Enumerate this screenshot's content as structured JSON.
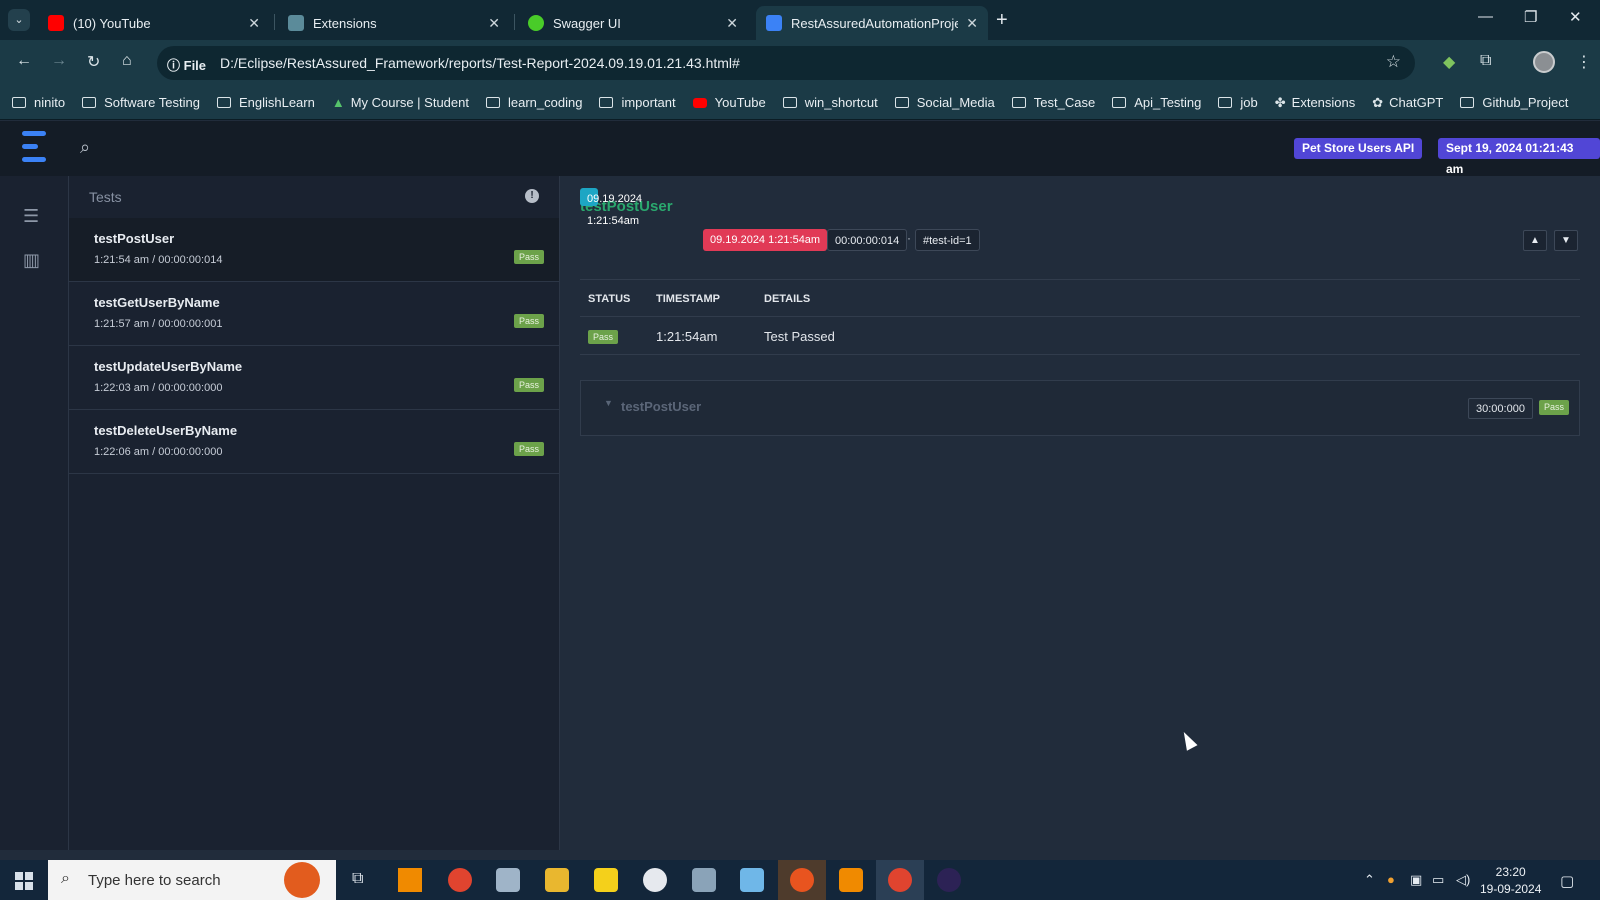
{
  "browser": {
    "tabs": [
      {
        "title": "(10) YouTube",
        "icon": "youtube-icon"
      },
      {
        "title": "Extensions",
        "icon": "puzzle-icon"
      },
      {
        "title": "Swagger UI",
        "icon": "swagger-icon"
      },
      {
        "title": "RestAssuredAutomationProject",
        "icon": "extent-report-icon",
        "active": true
      }
    ],
    "address": {
      "scheme_label": "File",
      "url": "D:/Eclipse/RestAssured_Framework/reports/Test-Report-2024.09.19.01.21.43.html#"
    },
    "bookmarks": [
      {
        "label": "ninito",
        "icon": "folder-icon"
      },
      {
        "label": "Software Testing",
        "icon": "folder-icon"
      },
      {
        "label": "EnglishLearn",
        "icon": "folder-icon"
      },
      {
        "label": "My Course | Student",
        "icon": "course-icon"
      },
      {
        "label": "learn_coding",
        "icon": "folder-icon"
      },
      {
        "label": "important",
        "icon": "folder-icon"
      },
      {
        "label": "YouTube",
        "icon": "youtube-icon"
      },
      {
        "label": "win_shortcut",
        "icon": "folder-icon"
      },
      {
        "label": "Social_Media",
        "icon": "folder-icon"
      },
      {
        "label": "Test_Case",
        "icon": "folder-icon"
      },
      {
        "label": "Api_Testing",
        "icon": "folder-icon"
      },
      {
        "label": "job",
        "icon": "folder-icon"
      },
      {
        "label": "Extensions",
        "icon": "puzzle-icon"
      },
      {
        "label": "ChatGPT",
        "icon": "chatgpt-icon"
      },
      {
        "label": "Github_Project",
        "icon": "folder-icon"
      }
    ]
  },
  "report": {
    "header": {
      "suite_badge": "Pet Store Users API",
      "date_badge": "Sept 19, 2024 01:21:43 am"
    },
    "list": {
      "heading": "Tests",
      "tests": [
        {
          "name": "testPostUser",
          "meta": "1:21:54 am / 00:00:00:014",
          "status": "Pass",
          "active": true
        },
        {
          "name": "testGetUserByName",
          "meta": "1:21:57 am / 00:00:00:001",
          "status": "Pass"
        },
        {
          "name": "testUpdateUserByName",
          "meta": "1:22:03 am / 00:00:00:000",
          "status": "Pass"
        },
        {
          "name": "testDeleteUserByName",
          "meta": "1:22:06 am / 00:00:00:000",
          "status": "Pass"
        }
      ]
    },
    "detail": {
      "title": "testPostUser",
      "start_time": "09.19.2024 1:21:54am",
      "end_time": "09.19.2024 1:21:54am",
      "duration": "00:00:00:014",
      "separator": "·",
      "test_id": "#test-id=1",
      "table": {
        "headers": [
          "STATUS",
          "TIMESTAMP",
          "DETAILS"
        ],
        "rows": [
          {
            "status": "Pass",
            "timestamp": "1:21:54am",
            "details": "Test Passed"
          }
        ]
      },
      "node": {
        "name": "testPostUser",
        "time": "30:00:000",
        "status": "Pass"
      }
    }
  },
  "taskbar": {
    "search_placeholder": "Type here to search",
    "time": "23:20",
    "date": "19-09-2024"
  },
  "colors": {
    "pass": "#6ca24a",
    "title_green": "#2aa86e",
    "start_chip": "#1da6c4",
    "end_chip": "#e13a56",
    "header_badge": "#5146d6"
  }
}
